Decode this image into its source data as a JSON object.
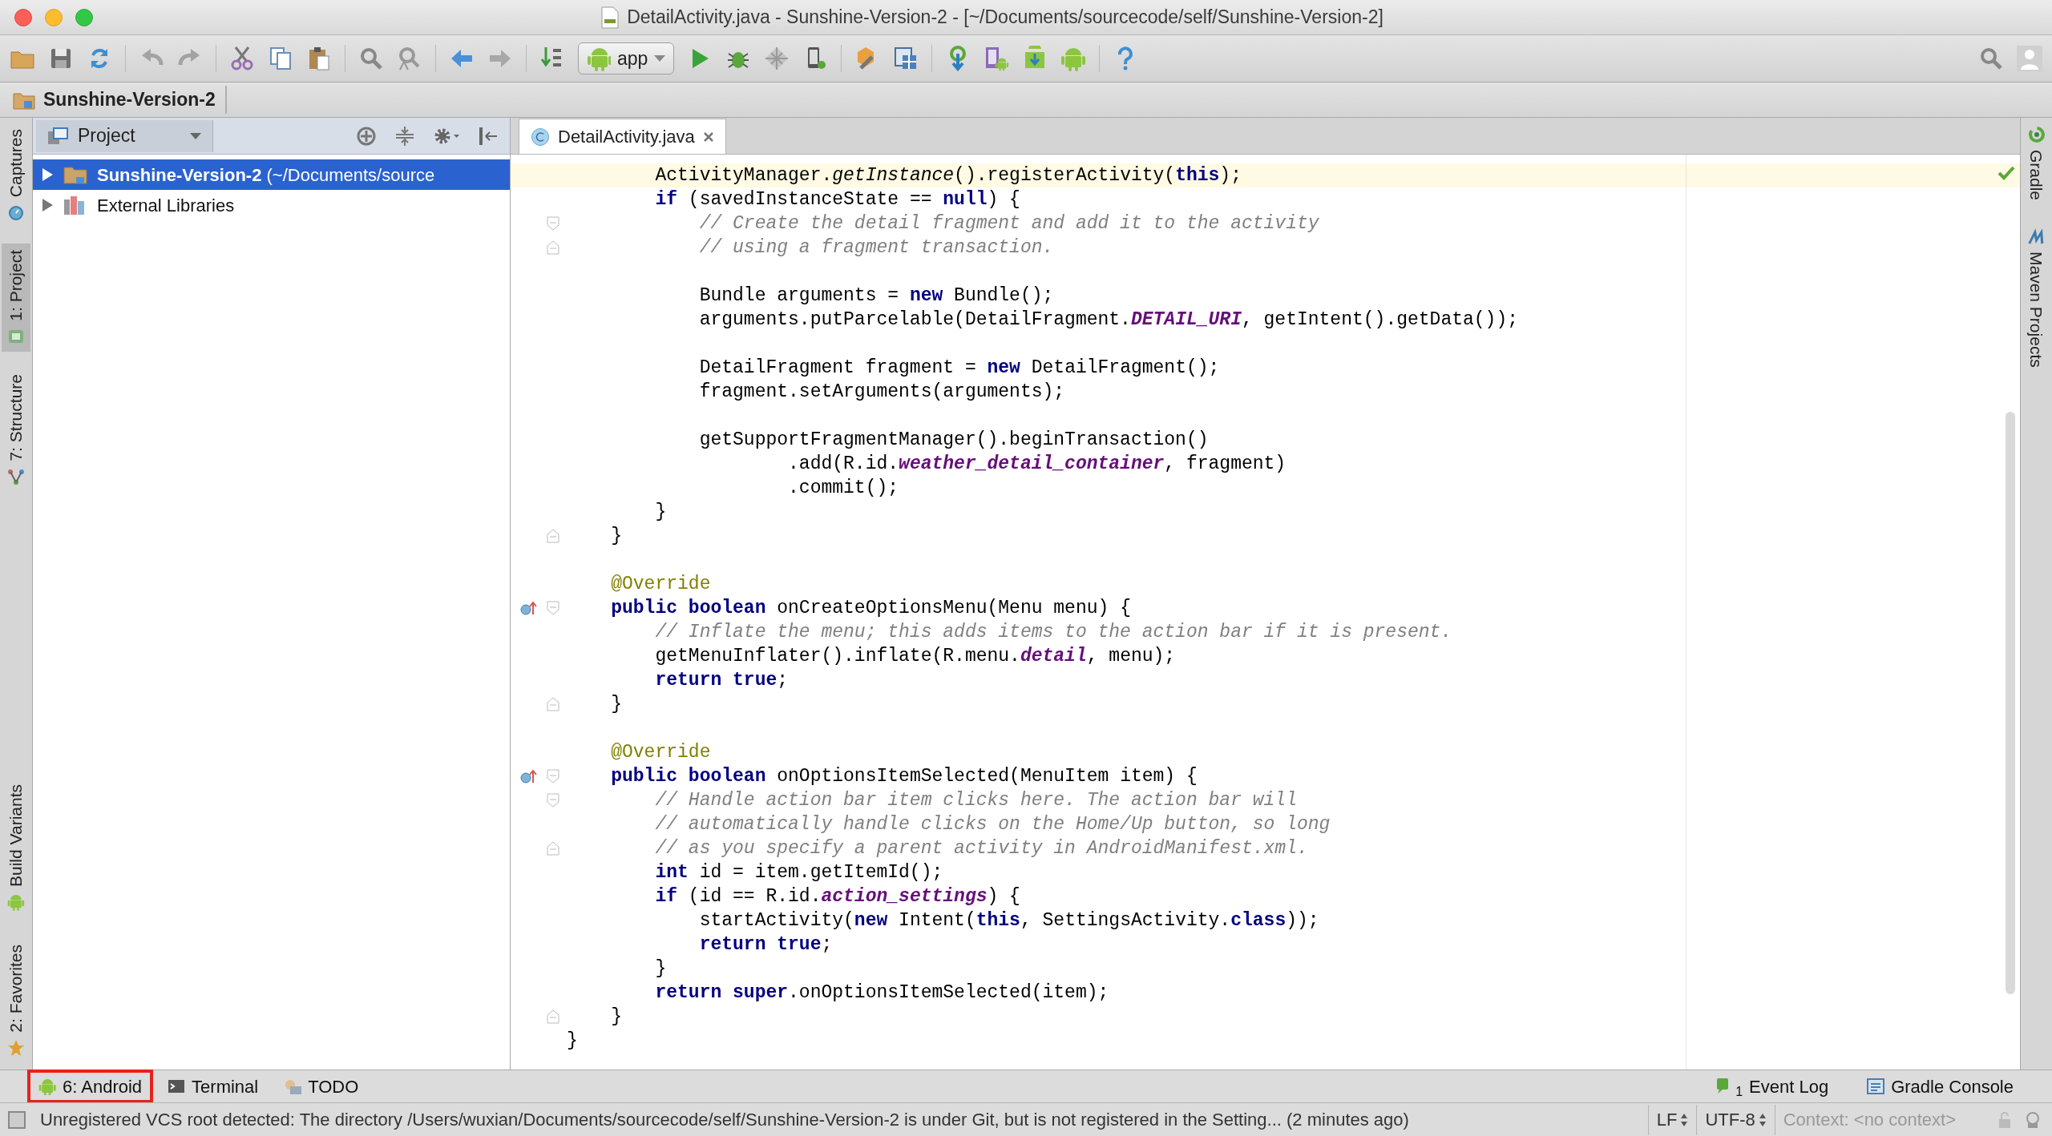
{
  "window": {
    "title": "DetailActivity.java - Sunshine-Version-2 - [~/Documents/sourcecode/self/Sunshine-Version-2]"
  },
  "toolbar": {
    "run_configuration": "app"
  },
  "navigation_bar": {
    "breadcrumbs": [
      "Sunshine-Version-2"
    ]
  },
  "left_tool_stripe": {
    "top": [
      {
        "label": "Captures",
        "kind": "captures",
        "selected": false
      },
      {
        "label": "1: Project",
        "kind": "project",
        "selected": true
      },
      {
        "label": "7: Structure",
        "kind": "structure",
        "selected": false
      }
    ],
    "bottom": [
      {
        "label": "Build Variants",
        "kind": "android",
        "selected": false
      },
      {
        "label": "2: Favorites",
        "kind": "star",
        "selected": false
      }
    ]
  },
  "project_panel": {
    "view": "Project",
    "tree": [
      {
        "label": "**Sunshine-Version-2** (~/Documents/source",
        "kind": "project",
        "expanded": false,
        "selected": true
      },
      {
        "label": "External Libraries",
        "kind": "libraries",
        "expanded": false,
        "selected": false
      }
    ]
  },
  "editor": {
    "tabs": [
      {
        "label": "DetailActivity.java",
        "selected": true
      }
    ],
    "lines": [
      {
        "current": true,
        "tokens": [
          {
            "kind": "plain",
            "text": "        ActivityManager."
          },
          {
            "kind": "static",
            "text": "getInstance"
          },
          {
            "kind": "plain",
            "text": "().registerActivity("
          },
          {
            "kind": "keyword",
            "text": "this"
          },
          {
            "kind": "plain",
            "text": ");"
          }
        ]
      },
      {
        "current": false,
        "tokens": [
          {
            "kind": "keyword",
            "text": "        if"
          },
          {
            "kind": "plain",
            "text": " (savedInstanceState == "
          },
          {
            "kind": "keyword",
            "text": "null"
          },
          {
            "kind": "plain",
            "text": ") {"
          }
        ]
      },
      {
        "current": false,
        "gutter": [
          {
            "kind": "fold_open"
          }
        ],
        "tokens": [
          {
            "kind": "comment",
            "text": "            // Create the detail fragment and add it to the activity"
          }
        ]
      },
      {
        "current": false,
        "gutter": [
          {
            "kind": "fold_close"
          }
        ],
        "tokens": [
          {
            "kind": "comment",
            "text": "            // using a fragment transaction."
          }
        ]
      },
      {
        "current": false
      },
      {
        "current": false,
        "tokens": [
          {
            "kind": "plain",
            "text": "            Bundle arguments = "
          },
          {
            "kind": "keyword",
            "text": "new"
          },
          {
            "kind": "plain",
            "text": " Bundle();"
          }
        ]
      },
      {
        "current": false,
        "tokens": [
          {
            "kind": "plain",
            "text": "            arguments.putParcelable(DetailFragment."
          },
          {
            "kind": "field",
            "text": "DETAIL_URI"
          },
          {
            "kind": "plain",
            "text": ", getIntent().getData());"
          }
        ]
      },
      {
        "current": false
      },
      {
        "current": false,
        "tokens": [
          {
            "kind": "plain",
            "text": "            DetailFragment fragment = "
          },
          {
            "kind": "keyword",
            "text": "new"
          },
          {
            "kind": "plain",
            "text": " DetailFragment();"
          }
        ]
      },
      {
        "current": false,
        "tokens": [
          {
            "kind": "plain",
            "text": "            fragment.setArguments(arguments);"
          }
        ]
      },
      {
        "current": false
      },
      {
        "current": false,
        "tokens": [
          {
            "kind": "plain",
            "text": "            getSupportFragmentManager().beginTransaction()"
          }
        ]
      },
      {
        "current": false,
        "tokens": [
          {
            "kind": "plain",
            "text": "                    .add(R.id."
          },
          {
            "kind": "field",
            "text": "weather_detail_container"
          },
          {
            "kind": "plain",
            "text": ", fragment)"
          }
        ]
      },
      {
        "current": false,
        "tokens": [
          {
            "kind": "plain",
            "text": "                    .commit();"
          }
        ]
      },
      {
        "current": false,
        "tokens": [
          {
            "kind": "plain",
            "text": "        }"
          }
        ]
      },
      {
        "current": false,
        "gutter": [
          {
            "kind": "fold_close"
          }
        ],
        "tokens": [
          {
            "kind": "plain",
            "text": "    }"
          }
        ]
      },
      {
        "current": false
      },
      {
        "current": false,
        "tokens": [
          {
            "kind": "annotation",
            "text": "    @Override"
          }
        ]
      },
      {
        "current": false,
        "gutter": [
          {
            "kind": "override"
          },
          {
            "kind": "fold_open"
          }
        ],
        "tokens": [
          {
            "kind": "keyword",
            "text": "    public boolean"
          },
          {
            "kind": "plain",
            "text": " onCreateOptionsMenu(Menu menu) {"
          }
        ]
      },
      {
        "current": false,
        "tokens": [
          {
            "kind": "comment",
            "text": "        // Inflate the menu; this adds items to the action bar if it is present."
          }
        ]
      },
      {
        "current": false,
        "tokens": [
          {
            "kind": "plain",
            "text": "        getMenuInflater().inflate(R.menu."
          },
          {
            "kind": "field",
            "text": "detail"
          },
          {
            "kind": "plain",
            "text": ", menu);"
          }
        ]
      },
      {
        "current": false,
        "tokens": [
          {
            "kind": "keyword",
            "text": "        return true"
          },
          {
            "kind": "plain",
            "text": ";"
          }
        ]
      },
      {
        "current": false,
        "gutter": [
          {
            "kind": "fold_close"
          }
        ],
        "tokens": [
          {
            "kind": "plain",
            "text": "    }"
          }
        ]
      },
      {
        "current": false
      },
      {
        "current": false,
        "tokens": [
          {
            "kind": "annotation",
            "text": "    @Override"
          }
        ]
      },
      {
        "current": false,
        "gutter": [
          {
            "kind": "override"
          },
          {
            "kind": "fold_open"
          }
        ],
        "tokens": [
          {
            "kind": "keyword",
            "text": "    public boolean"
          },
          {
            "kind": "plain",
            "text": " onOptionsItemSelected(MenuItem item) {"
          }
        ]
      },
      {
        "current": false,
        "gutter": [
          {
            "kind": "fold_open"
          }
        ],
        "tokens": [
          {
            "kind": "comment",
            "text": "        // Handle action bar item clicks here. The action bar will"
          }
        ]
      },
      {
        "current": false,
        "tokens": [
          {
            "kind": "comment",
            "text": "        // automatically handle clicks on the Home/Up button, so long"
          }
        ]
      },
      {
        "current": false,
        "gutter": [
          {
            "kind": "fold_close"
          }
        ],
        "tokens": [
          {
            "kind": "comment",
            "text": "        // as you specify a parent activity in AndroidManifest.xml."
          }
        ]
      },
      {
        "current": false,
        "tokens": [
          {
            "kind": "keyword",
            "text": "        int"
          },
          {
            "kind": "plain",
            "text": " id = item.getItemId();"
          }
        ]
      },
      {
        "current": false,
        "tokens": [
          {
            "kind": "keyword",
            "text": "        if"
          },
          {
            "kind": "plain",
            "text": " (id == R.id."
          },
          {
            "kind": "field",
            "text": "action_settings"
          },
          {
            "kind": "plain",
            "text": ") {"
          }
        ]
      },
      {
        "current": false,
        "tokens": [
          {
            "kind": "plain",
            "text": "            startActivity("
          },
          {
            "kind": "keyword",
            "text": "new"
          },
          {
            "kind": "plain",
            "text": " Intent("
          },
          {
            "kind": "keyword",
            "text": "this"
          },
          {
            "kind": "plain",
            "text": ", SettingsActivity."
          },
          {
            "kind": "keyword",
            "text": "class"
          },
          {
            "kind": "plain",
            "text": "));"
          }
        ]
      },
      {
        "current": false,
        "tokens": [
          {
            "kind": "keyword",
            "text": "            return true"
          },
          {
            "kind": "plain",
            "text": ";"
          }
        ]
      },
      {
        "current": false,
        "tokens": [
          {
            "kind": "plain",
            "text": "        }"
          }
        ]
      },
      {
        "current": false,
        "tokens": [
          {
            "kind": "keyword",
            "text": "        return super"
          },
          {
            "kind": "plain",
            "text": ".onOptionsItemSelected(item);"
          }
        ]
      },
      {
        "current": false,
        "gutter": [
          {
            "kind": "fold_close"
          }
        ],
        "tokens": [
          {
            "kind": "plain",
            "text": "    }"
          }
        ]
      },
      {
        "current": false,
        "tokens": [
          {
            "kind": "plain",
            "text": "}"
          }
        ]
      }
    ]
  },
  "right_tool_stripe": [
    {
      "label": "Gradle",
      "kind": "gradle"
    },
    {
      "label": "Maven Projects",
      "kind": "maven"
    }
  ],
  "bottom_tool_bar": {
    "left": [
      {
        "label": "6: Android",
        "kind": "android",
        "highlighted": true
      },
      {
        "label": "Terminal",
        "kind": "terminal",
        "highlighted": false
      },
      {
        "label": "TODO",
        "kind": "todo",
        "highlighted": false
      }
    ],
    "right": [
      {
        "label": "Event Log",
        "kind": "event",
        "badge": "1"
      },
      {
        "label": "Gradle Console",
        "kind": "console"
      }
    ]
  },
  "status_bar": {
    "message": "Unregistered VCS root detected: The directory /Users/wuxian/Documents/sourcecode/self/Sunshine-Version-2 is under Git, but is not registered in the Setting... (2 minutes ago)",
    "line_separator": "LF",
    "encoding": "UTF-8",
    "context": "Context: <no context>"
  }
}
